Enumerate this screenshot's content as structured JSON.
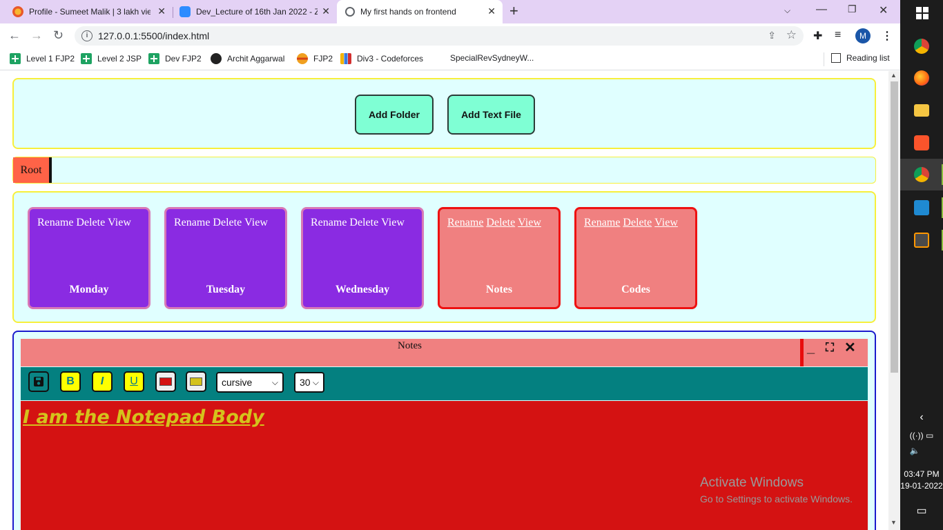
{
  "browser": {
    "tabs": [
      {
        "label": "Profile - Sumeet Malik | 3 lakh vie",
        "icon": "pizza-icon",
        "active": false
      },
      {
        "label": "Dev_Lecture of 16th Jan 2022 - Z",
        "icon": "zoom-icon",
        "active": false
      },
      {
        "label": "My first hands on frontend",
        "icon": "globe-icon",
        "active": true
      }
    ],
    "url": "127.0.0.1:5500/index.html",
    "profile_initial": "M",
    "bookmarks": [
      {
        "label": "Level 1 FJP2",
        "icon": "sheets-icon"
      },
      {
        "label": "Level 2 JSP",
        "icon": "sheets-icon"
      },
      {
        "label": "Dev FJP2",
        "icon": "sheets-icon"
      },
      {
        "label": "Archit Aggarwal",
        "icon": "github-icon"
      },
      {
        "label": "FJP2",
        "icon": "burger-icon"
      },
      {
        "label": "Div3 - Codeforces",
        "icon": "codeforces-icon"
      },
      {
        "label": "SpecialRevSydneyW...",
        "icon": "none"
      }
    ],
    "reading_list": "Reading list"
  },
  "page": {
    "buttons": {
      "add_folder": "Add Folder",
      "add_text_file": "Add Text File"
    },
    "breadcrumb": {
      "root": "Root"
    },
    "items": [
      {
        "name": "Monday",
        "type": "folder",
        "actions": [
          "Rename",
          "Delete",
          "View"
        ]
      },
      {
        "name": "Tuesday",
        "type": "folder",
        "actions": [
          "Rename",
          "Delete",
          "View"
        ]
      },
      {
        "name": "Wednesday",
        "type": "folder",
        "actions": [
          "Rename",
          "Delete",
          "View"
        ]
      },
      {
        "name": "Notes",
        "type": "file",
        "actions": [
          "Rename",
          "Delete",
          "View"
        ]
      },
      {
        "name": "Codes",
        "type": "file",
        "actions": [
          "Rename",
          "Delete",
          "View"
        ]
      }
    ],
    "notepad": {
      "title": "Notes",
      "toolbar": {
        "bold": "B",
        "italic": "I",
        "underline": "U",
        "text_color": "#d41212",
        "bg_color": "#d4c21c",
        "font_family": "cursive",
        "font_size": "30"
      },
      "body": "I am the Notepad Body"
    },
    "colors": {
      "folder_bg": "#8a2be2",
      "file_bg": "#f08080",
      "panel_bg": "#e0ffff",
      "button_bg": "#7fffd4"
    }
  },
  "watermark": {
    "line1": "Activate Windows",
    "line2": "Go to Settings to activate Windows."
  },
  "taskbar": {
    "time": "03:47 PM",
    "date": "19-01-2022"
  }
}
